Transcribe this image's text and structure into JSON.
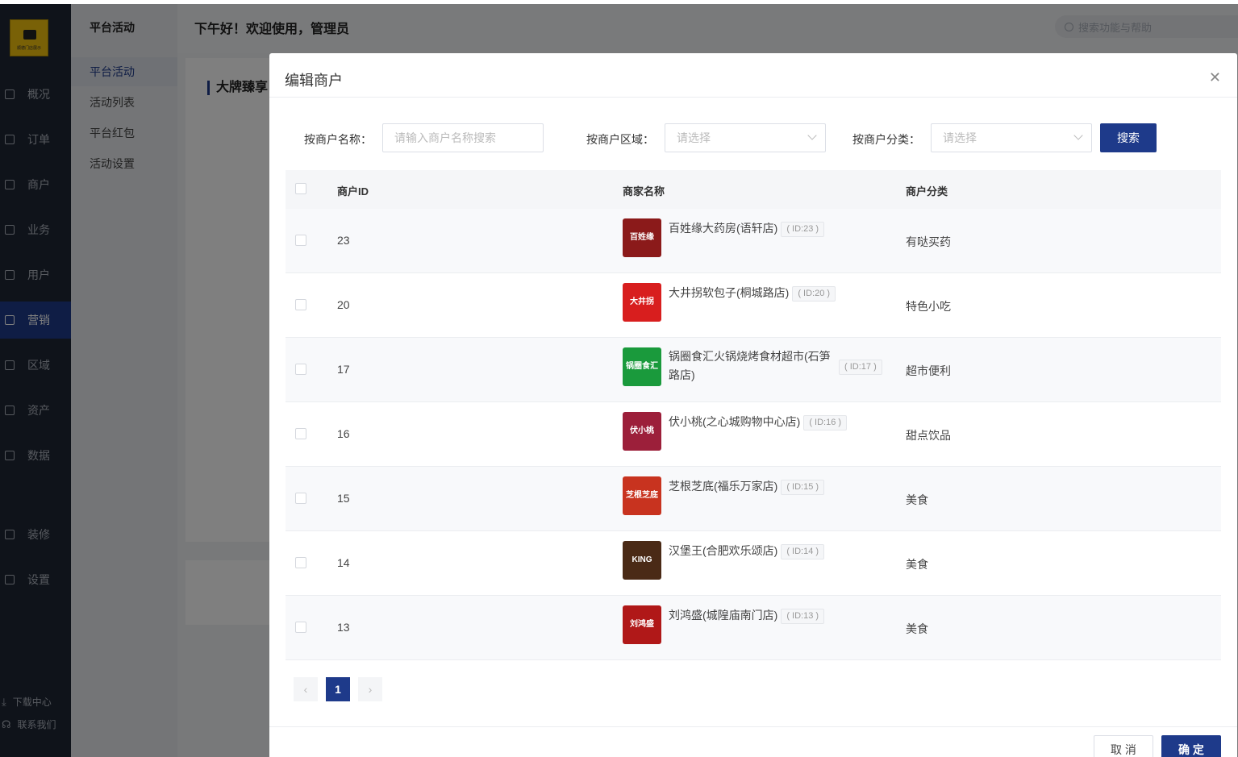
{
  "app": {
    "logo_text": "顺德门店展示",
    "greeting": "下午好！欢迎使用，管理员",
    "search_placeholder": "搜索功能与帮助"
  },
  "nav": {
    "items": [
      {
        "label": "概况",
        "icon": "overview-icon"
      },
      {
        "label": "订单",
        "icon": "order-icon"
      },
      {
        "label": "商户",
        "icon": "merchant-icon"
      },
      {
        "label": "业务",
        "icon": "business-icon"
      },
      {
        "label": "用户",
        "icon": "user-icon"
      },
      {
        "label": "营销",
        "icon": "marketing-icon",
        "active": true
      },
      {
        "label": "区域",
        "icon": "region-icon"
      },
      {
        "label": "资产",
        "icon": "asset-icon"
      },
      {
        "label": "数据",
        "icon": "data-icon"
      },
      {
        "label": "装修",
        "icon": "decorate-icon"
      },
      {
        "label": "设置",
        "icon": "settings-icon"
      }
    ],
    "bottom": [
      {
        "label": "下载中心",
        "icon": "download-icon"
      },
      {
        "label": "联系我们",
        "icon": "headset-icon"
      }
    ]
  },
  "subnav": {
    "title": "平台活动",
    "items": [
      {
        "label": "平台活动",
        "active": true
      },
      {
        "label": "活动列表"
      },
      {
        "label": "平台红包"
      },
      {
        "label": "活动设置"
      }
    ]
  },
  "content": {
    "section_title": "大牌臻享"
  },
  "modal": {
    "title": "编辑商户",
    "filters": {
      "name_label": "按商户名称：",
      "name_placeholder": "请输入商户名称搜索",
      "region_label": "按商户区域：",
      "region_placeholder": "请选择",
      "category_label": "按商户分类：",
      "category_placeholder": "请选择",
      "search_button": "搜索"
    },
    "columns": {
      "id": "商户ID",
      "name": "商家名称",
      "category": "商户分类"
    },
    "rows": [
      {
        "id": "23",
        "name": "百姓缘大药房(语轩店)",
        "badge": "( ID:23 )",
        "category": "有哒买药",
        "logo_text": "百姓缘",
        "logo_color": "#8b1a1a"
      },
      {
        "id": "20",
        "name": "大井拐软包子(桐城路店)",
        "badge": "( ID:20 )",
        "category": "特色小吃",
        "logo_text": "大井拐",
        "logo_color": "#d81e1e"
      },
      {
        "id": "17",
        "name": "锅圈食汇火锅烧烤食材超市(石笋路店)",
        "badge": "( ID:17 )",
        "category": "超市便利",
        "logo_text": "锅圈食汇",
        "logo_color": "#1a9a3c"
      },
      {
        "id": "16",
        "name": "伏小桃(之心城购物中心店)",
        "badge": "( ID:16 )",
        "category": "甜点饮品",
        "logo_text": "伏小桃",
        "logo_color": "#9c1f3a"
      },
      {
        "id": "15",
        "name": "芝根芝底(福乐万家店)",
        "badge": "( ID:15 )",
        "category": "美食",
        "logo_text": "芝根芝底",
        "logo_color": "#c8331f"
      },
      {
        "id": "14",
        "name": "汉堡王(合肥欢乐颂店)",
        "badge": "( ID:14 )",
        "category": "美食",
        "logo_text": "KING",
        "logo_color": "#4a2a16"
      },
      {
        "id": "13",
        "name": "刘鸿盛(城隍庙南门店)",
        "badge": "( ID:13 )",
        "category": "美食",
        "logo_text": "刘鸿盛",
        "logo_color": "#b01818"
      }
    ],
    "pagination": {
      "prev": "‹",
      "current": "1",
      "next": "›"
    },
    "cancel_button": "取 消",
    "ok_button": "确 定"
  }
}
